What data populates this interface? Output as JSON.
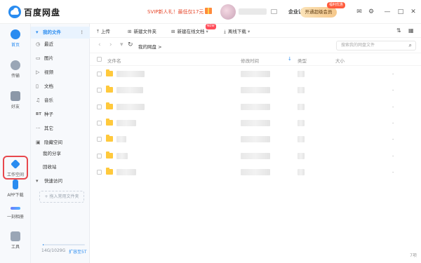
{
  "header": {
    "brand": "百度网盘",
    "promo": "SVIP新人礼！最低仅17元",
    "enterprise": "企业认证",
    "vip_button": "开通超级会员",
    "vip_badge": "福利优惠"
  },
  "rail": [
    {
      "label": "首页"
    },
    {
      "label": "传输"
    },
    {
      "label": "好友"
    },
    {
      "label": "工作空间"
    },
    {
      "label": "APP下载"
    },
    {
      "label": "一刻相册"
    },
    {
      "label": "工具"
    }
  ],
  "sidebar": {
    "my_files": "我的文件",
    "items": [
      "最近",
      "图片",
      "视频",
      "文档",
      "音乐",
      "种子",
      "其它",
      "隐藏空间"
    ],
    "my_share": "我的分享",
    "recycle": "回收站",
    "quick_access": "快速访问",
    "add_common": "+ 拖入常用文件夹",
    "quota": "14G/1029G",
    "quota_fraction": 0.014,
    "expand": "扩容至5T"
  },
  "toolbar": {
    "upload": "上传",
    "new_folder": "新建文件夹",
    "new_online_doc": "新建在线文档",
    "new_badge": "NEW",
    "offline_download": "离线下载"
  },
  "nav": {
    "breadcrumb": "我的网盘  >",
    "search_placeholder": "搜索我的网盘文件"
  },
  "table": {
    "columns": [
      "文件名",
      "修改时间",
      "类型",
      "大小"
    ],
    "rows": [
      {
        "size": "-"
      },
      {
        "size": "-"
      },
      {
        "size": "-"
      },
      {
        "size": "-"
      },
      {
        "size": "-"
      },
      {
        "size": "-"
      },
      {
        "size": "-"
      }
    ],
    "count": "7项"
  },
  "colors": {
    "accent": "#2a8cf0",
    "folder": "#ffc93c",
    "highlight": "#e8484d"
  }
}
